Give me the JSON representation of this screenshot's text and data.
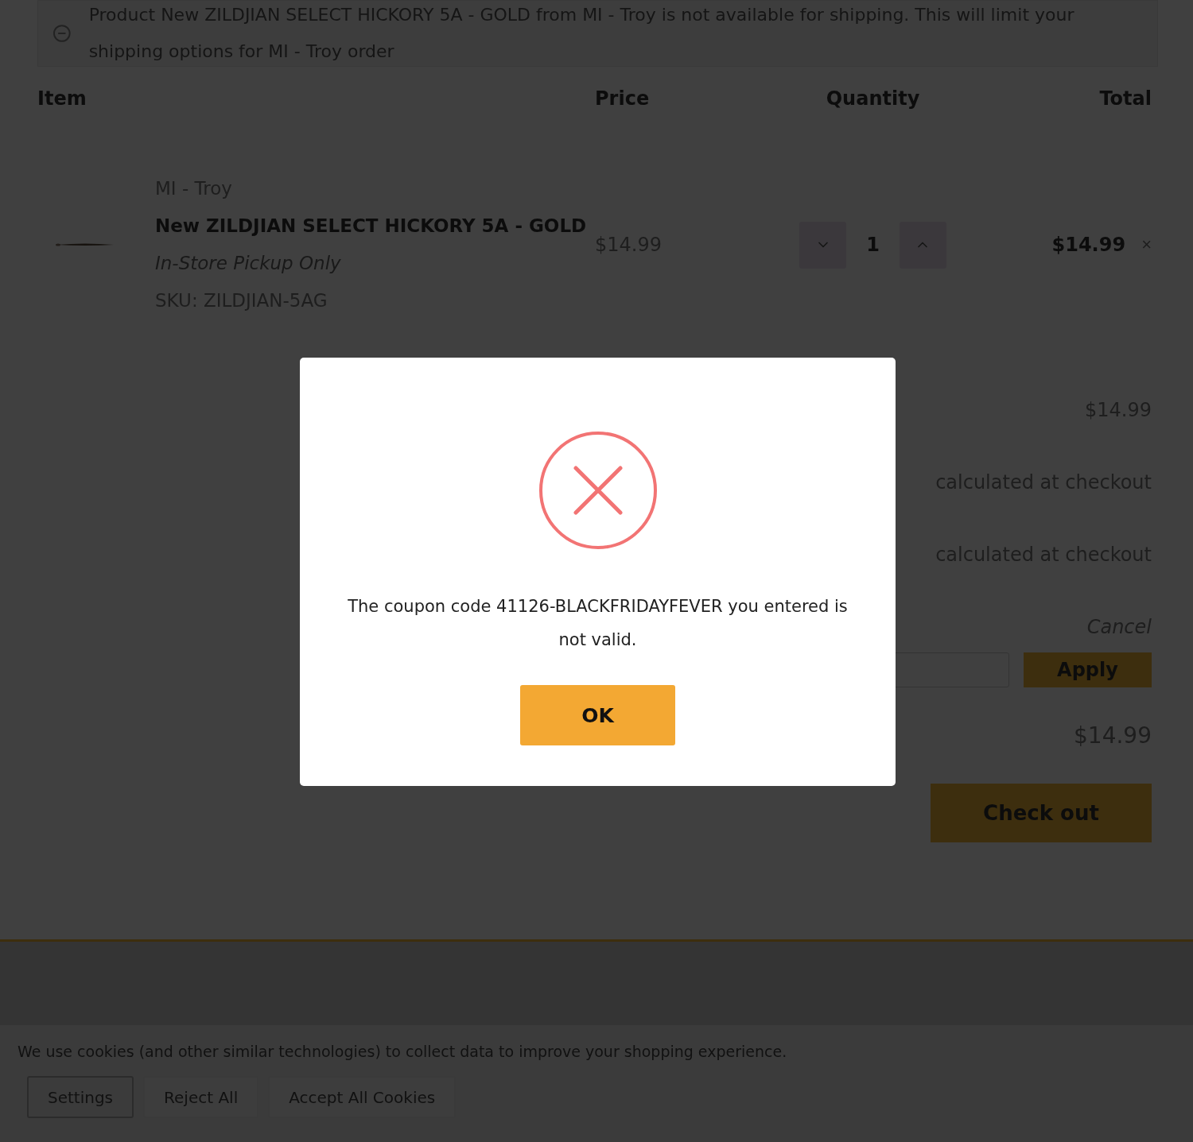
{
  "notice": {
    "text": "Product New ZILDJIAN SELECT HICKORY 5A - GOLD from MI - Troy is not available for shipping. This will limit your shipping options for MI - Troy order"
  },
  "table": {
    "columns": [
      "Item",
      "Price",
      "Quantity",
      "Total"
    ],
    "rows": [
      {
        "store": "MI - Troy",
        "name": "New ZILDJIAN SELECT HICKORY 5A - GOLD",
        "note": "In-Store Pickup Only",
        "sku": "SKU: ZILDJIAN-5AG",
        "price": "$14.99",
        "quantity": "1",
        "total": "$14.99",
        "remove": "×"
      }
    ]
  },
  "summary": {
    "values": [
      "$14.99",
      "calculated at checkout",
      "calculated at checkout"
    ],
    "cancel": "Cancel",
    "apply": "Apply",
    "total": "$14.99",
    "checkout": "Check out"
  },
  "cookies": {
    "text": "We use cookies (and other similar technologies) to collect data to improve your shopping experience.",
    "buttons": [
      {
        "label": "Settings",
        "kind": "outline"
      },
      {
        "label": "Reject All",
        "kind": "filled"
      },
      {
        "label": "Accept All Cookies",
        "kind": "filled"
      }
    ]
  },
  "dialog": {
    "message": "The coupon code 41126-BLACKFRIDAYFEVER you entered is not valid.",
    "button": "OK"
  }
}
